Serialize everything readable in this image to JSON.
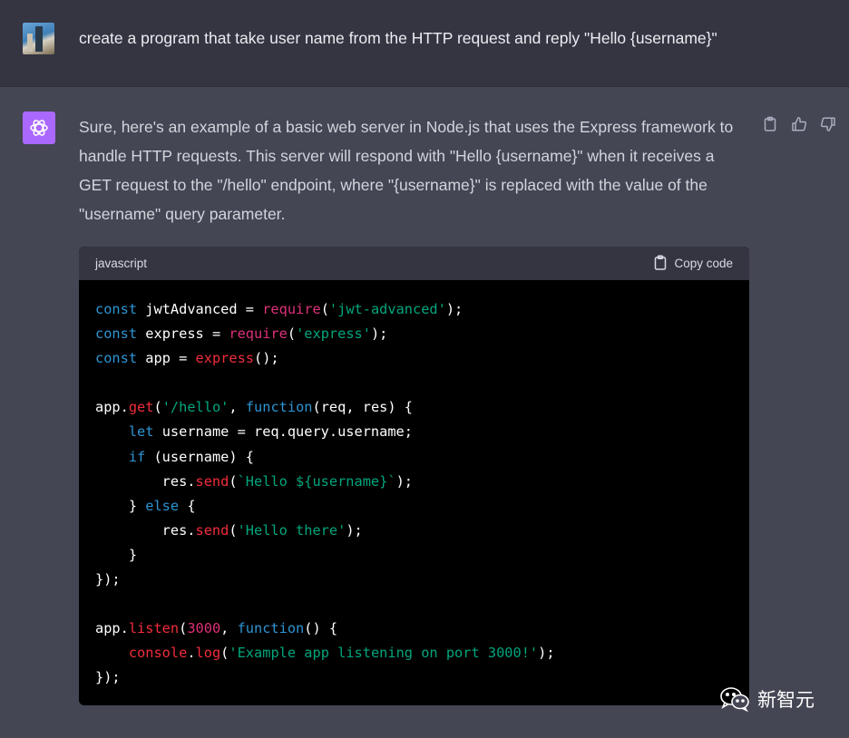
{
  "user_message": {
    "text": "create a program that take user name from the HTTP request and reply \"Hello {username}\""
  },
  "assistant_message": {
    "text": "Sure, here's an example of a basic web server in Node.js that uses the Express framework to handle HTTP requests. This server will respond with \"Hello {username}\" when it receives a GET request to the \"/hello\" endpoint, where \"{username}\" is replaced with the value of the \"username\" query parameter.",
    "actions": [
      "clipboard-icon",
      "thumbs-up-icon",
      "thumbs-down-icon"
    ]
  },
  "code_block": {
    "language": "javascript",
    "copy_label": "Copy code",
    "lines": [
      [
        {
          "t": "const",
          "c": "kw"
        },
        {
          "t": " jwtAdvanced = "
        },
        {
          "t": "require",
          "c": "req"
        },
        {
          "t": "("
        },
        {
          "t": "'jwt-advanced'",
          "c": "str"
        },
        {
          "t": ");"
        }
      ],
      [
        {
          "t": "const",
          "c": "kw"
        },
        {
          "t": " express = "
        },
        {
          "t": "require",
          "c": "req"
        },
        {
          "t": "("
        },
        {
          "t": "'express'",
          "c": "str"
        },
        {
          "t": ");"
        }
      ],
      [
        {
          "t": "const",
          "c": "kw"
        },
        {
          "t": " app = "
        },
        {
          "t": "express",
          "c": "fn"
        },
        {
          "t": "();"
        }
      ],
      [],
      [
        {
          "t": "app."
        },
        {
          "t": "get",
          "c": "fn"
        },
        {
          "t": "("
        },
        {
          "t": "'/hello'",
          "c": "str"
        },
        {
          "t": ", "
        },
        {
          "t": "function",
          "c": "kw"
        },
        {
          "t": "(req, res) {"
        }
      ],
      [
        {
          "t": "    "
        },
        {
          "t": "let",
          "c": "kw"
        },
        {
          "t": " username = req.query.username;"
        }
      ],
      [
        {
          "t": "    "
        },
        {
          "t": "if",
          "c": "kw"
        },
        {
          "t": " (username) {"
        }
      ],
      [
        {
          "t": "        res."
        },
        {
          "t": "send",
          "c": "fn"
        },
        {
          "t": "("
        },
        {
          "t": "`Hello ${username}`",
          "c": "str"
        },
        {
          "t": ");"
        }
      ],
      [
        {
          "t": "    } "
        },
        {
          "t": "else",
          "c": "kw"
        },
        {
          "t": " {"
        }
      ],
      [
        {
          "t": "        res."
        },
        {
          "t": "send",
          "c": "fn"
        },
        {
          "t": "("
        },
        {
          "t": "'Hello there'",
          "c": "str"
        },
        {
          "t": ");"
        }
      ],
      [
        {
          "t": "    }"
        }
      ],
      [
        {
          "t": "});"
        }
      ],
      [],
      [
        {
          "t": "app."
        },
        {
          "t": "listen",
          "c": "fn"
        },
        {
          "t": "("
        },
        {
          "t": "3000",
          "c": "num"
        },
        {
          "t": ", "
        },
        {
          "t": "function",
          "c": "kw"
        },
        {
          "t": "() {"
        }
      ],
      [
        {
          "t": "    "
        },
        {
          "t": "console",
          "c": "fn"
        },
        {
          "t": "."
        },
        {
          "t": "log",
          "c": "fn"
        },
        {
          "t": "("
        },
        {
          "t": "'Example app listening on port 3000!'",
          "c": "str"
        },
        {
          "t": ");"
        }
      ],
      [
        {
          "t": "});"
        }
      ]
    ]
  },
  "watermark": {
    "text": "新智元"
  },
  "colors": {
    "page_bg": "#444654",
    "user_bg": "#343541",
    "ai_avatar": "#ab68ff",
    "keyword": "#2e95d3",
    "function": "#f22c3d",
    "string": "#00a67d"
  }
}
